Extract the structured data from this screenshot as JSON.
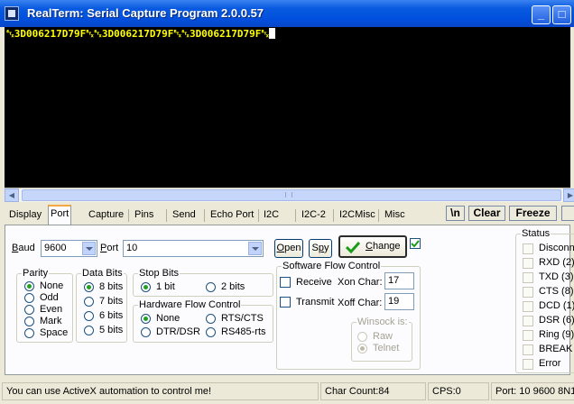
{
  "window": {
    "title": "RealTerm: Serial Capture Program 2.0.0.57",
    "minimize_label": "_",
    "maximize_label": "□"
  },
  "terminal": {
    "text": "␂3D006217D79F␃␂3D006217D79F␃␂3D006217D79F␃"
  },
  "tabs": [
    {
      "label": "Display"
    },
    {
      "label": "Port",
      "active": true
    },
    {
      "label": "Capture"
    },
    {
      "label": "Pins"
    },
    {
      "label": "Send"
    },
    {
      "label": "Echo Port"
    },
    {
      "label": "I2C"
    },
    {
      "label": "I2C-2"
    },
    {
      "label": "I2CMisc"
    },
    {
      "label": "Misc"
    }
  ],
  "toolbar": {
    "newline_label": "\\n",
    "clear_label": "Clear",
    "freeze_label": "Freeze"
  },
  "port": {
    "baud_label": "Baud",
    "baud_value": "9600",
    "port_label": "Port",
    "port_value": "10",
    "open_label": "Open",
    "spy_label": "Spy",
    "change_label": "Change",
    "change_checked": true
  },
  "parity": {
    "title": "Parity",
    "options": [
      "None",
      "Odd",
      "Even",
      "Mark",
      "Space"
    ],
    "selected": "None"
  },
  "data_bits": {
    "title": "Data Bits",
    "options": [
      "8 bits",
      "7 bits",
      "6 bits",
      "5 bits"
    ],
    "selected": "8 bits"
  },
  "stop_bits": {
    "title": "Stop Bits",
    "options": [
      "1 bit",
      "2 bits"
    ],
    "selected": "1 bit"
  },
  "hardware_flow": {
    "title": "Hardware Flow Control",
    "options": [
      "None",
      "RTS/CTS",
      "DTR/DSR",
      "RS485-rts"
    ],
    "selected": "None"
  },
  "software_flow": {
    "title": "Software Flow Control",
    "receive_label": "Receive",
    "transmit_label": "Transmit",
    "xon_label": "Xon Char:",
    "xon_value": "17",
    "xoff_label": "Xoff Char:",
    "xoff_value": "19"
  },
  "winsock": {
    "title": "Winsock is:",
    "options": [
      "Raw",
      "Telnet"
    ],
    "selected": "Telnet"
  },
  "status": {
    "title": "Status",
    "items": [
      "Disconnect",
      "RXD (2)",
      "TXD (3)",
      "CTS (8)",
      "DCD (1)",
      "DSR (6)",
      "Ring (9)",
      "BREAK",
      "Error"
    ]
  },
  "statusbar": {
    "message": "You can use ActiveX automation to control me!",
    "char_count": "Char Count:84",
    "cps": "CPS:0",
    "port_info": "Port: 10 9600 8N1"
  }
}
